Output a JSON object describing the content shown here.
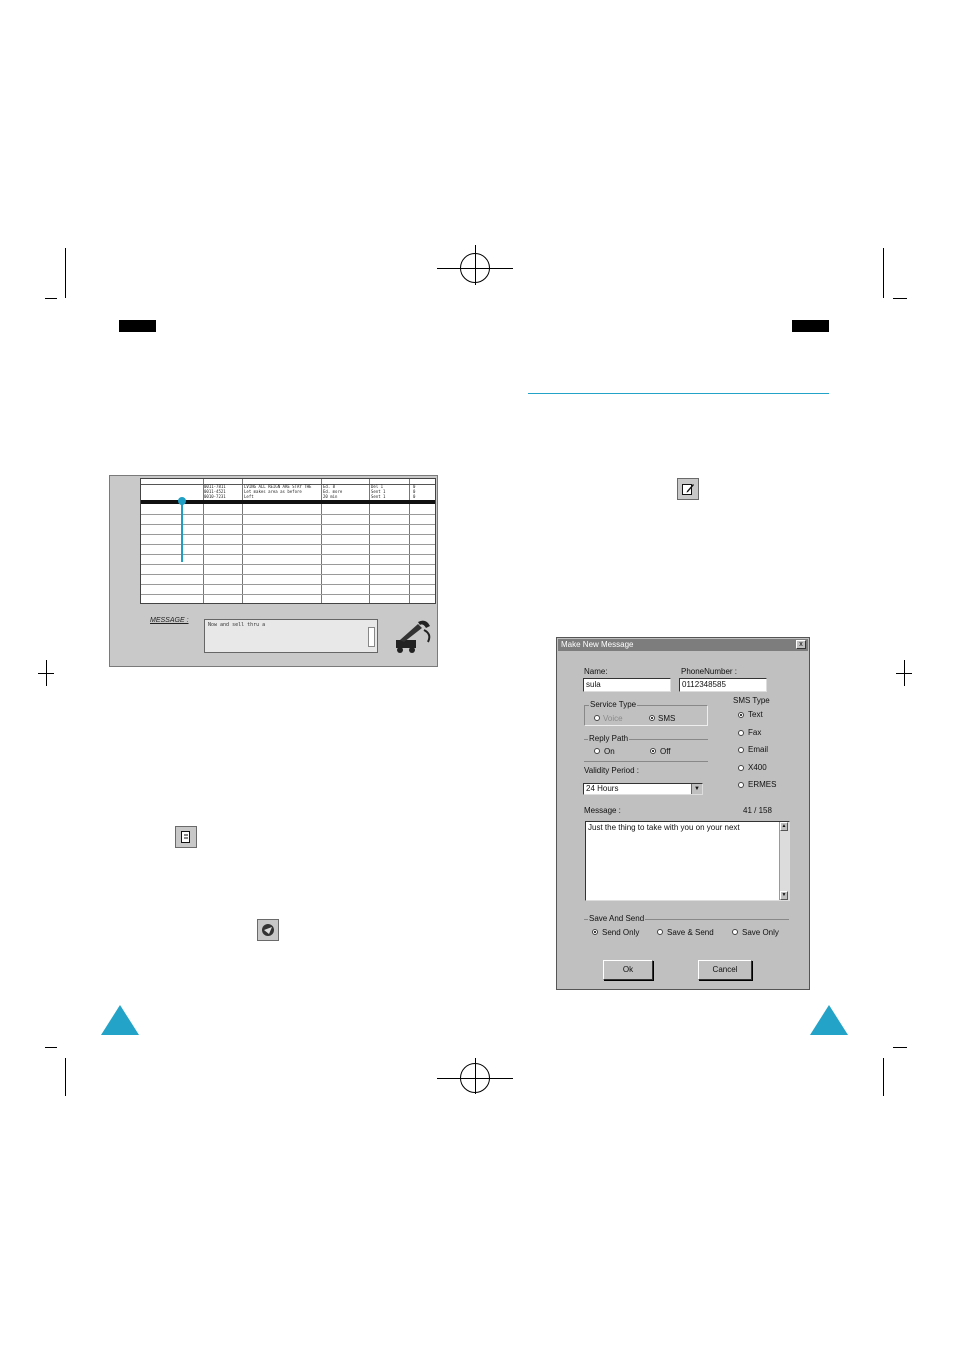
{
  "colors": {
    "accent": "#22a3c7"
  },
  "message_list_window": {
    "list_rows": [
      [
        "0011-7811",
        "LVING ALL REIGN ARE STAY THE",
        "Ed. 8",
        "Del 1",
        "0"
      ],
      [
        "0011-4521",
        "Let makes area as before",
        "Ed. more",
        "Sent 1",
        "0"
      ],
      [
        "0010-7231",
        "Left",
        "20 min",
        "Sent 1",
        "0"
      ],
      [
        "",
        "",
        "",
        "",
        ""
      ]
    ],
    "message_label": "MESSAGE :",
    "message_preview": "Now and sell thru a",
    "phone_icon": "phone-handset-icon"
  },
  "icons": {
    "new_message_icon": "new-message-icon",
    "reply_icon": "reply-icon",
    "send_icon": "send-icon"
  },
  "dialog": {
    "title": "Make New Message",
    "close_label": "x",
    "name_label": "Name:",
    "name_value": "sula",
    "phone_label": "PhoneNumber :",
    "phone_value": "0112348585",
    "service_type": {
      "label": "Service Type",
      "options": [
        "Voice",
        "SMS"
      ],
      "selected": "SMS"
    },
    "reply_path": {
      "label": "Reply Path",
      "options": [
        "On",
        "Off"
      ],
      "selected": "Off"
    },
    "validity_period": {
      "label": "Validity Period :",
      "value": "24 Hours"
    },
    "sms_type": {
      "label": "SMS Type",
      "options": [
        "Text",
        "Fax",
        "Email",
        "X400",
        "ERMES"
      ],
      "selected": "Text"
    },
    "message_label": "Message :",
    "char_count": "41 / 158",
    "message_value": "Just the thing to take with you on your next",
    "save_and_send": {
      "label": "Save And Send",
      "options": [
        "Send Only",
        "Save & Send",
        "Save Only"
      ],
      "selected": "Send Only"
    },
    "ok_label": "Ok",
    "cancel_label": "Cancel"
  }
}
